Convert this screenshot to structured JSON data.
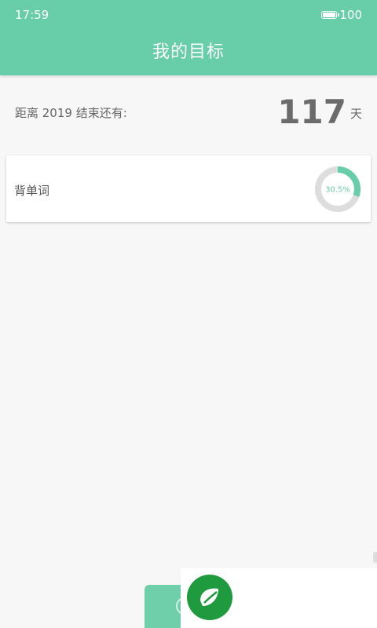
{
  "status_bar": {
    "time": "17:59",
    "battery": "100"
  },
  "header": {
    "title": "我的目标"
  },
  "countdown": {
    "label": "距离 2019 结束还有:",
    "days": "117",
    "unit": "天"
  },
  "goals": [
    {
      "name": "背单词",
      "progress": 0.305,
      "progress_label": "30.5%"
    }
  ],
  "colors": {
    "accent": "#68cda9",
    "ring_track": "#dddddd",
    "logo_green": "#1f9a3e"
  }
}
